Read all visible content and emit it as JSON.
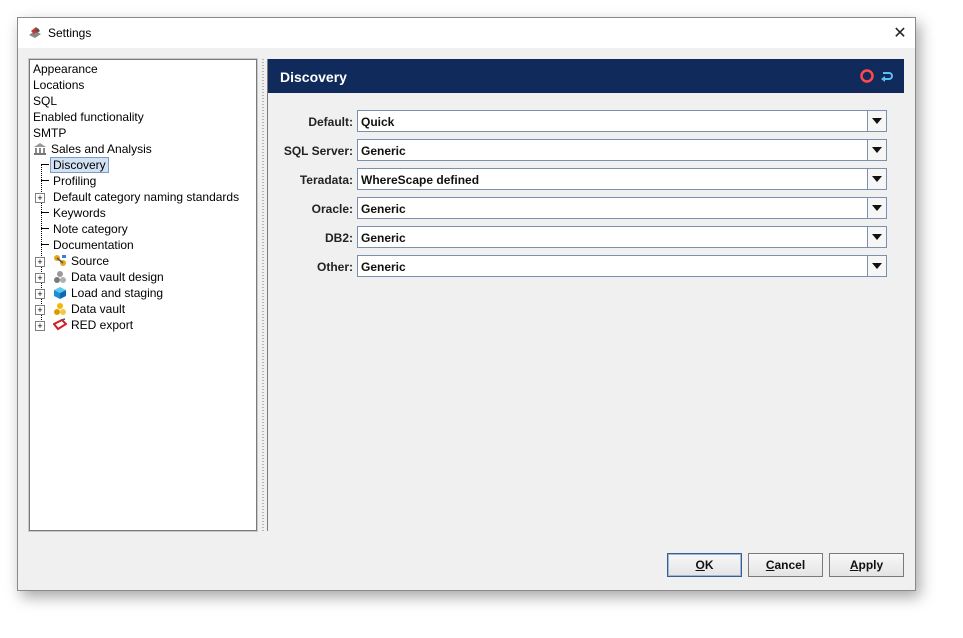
{
  "window": {
    "title": "Settings",
    "close_glyph": "✕"
  },
  "tree": {
    "items": [
      {
        "label": "Appearance"
      },
      {
        "label": "Locations"
      },
      {
        "label": "SQL"
      },
      {
        "label": "Enabled functionality"
      },
      {
        "label": "SMTP"
      },
      {
        "label": "Sales and Analysis",
        "icon": "bank-icon"
      },
      {
        "label": "Discovery",
        "selected": true
      },
      {
        "label": "Profiling"
      },
      {
        "label": "Default category naming standards",
        "expandable": true
      },
      {
        "label": "Keywords"
      },
      {
        "label": "Note category"
      },
      {
        "label": "Documentation"
      },
      {
        "label": "Source",
        "expandable": true,
        "icon": "source-icon"
      },
      {
        "label": "Data vault design",
        "expandable": true,
        "icon": "data-vault-design-icon"
      },
      {
        "label": "Load and staging",
        "expandable": true,
        "icon": "cube-icon"
      },
      {
        "label": "Data vault",
        "expandable": true,
        "icon": "data-vault-icon"
      },
      {
        "label": "RED export",
        "expandable": true,
        "icon": "red-export-icon"
      }
    ]
  },
  "panel": {
    "title": "Discovery",
    "rows": [
      {
        "label": "Default:",
        "value": "Quick"
      },
      {
        "label": "SQL Server:",
        "value": "Generic"
      },
      {
        "label": "Teradata:",
        "value": "WhereScape defined"
      },
      {
        "label": "Oracle:",
        "value": "Generic"
      },
      {
        "label": "DB2:",
        "value": "Generic"
      },
      {
        "label": "Other:",
        "value": "Generic"
      }
    ]
  },
  "buttons": {
    "ok": {
      "mnemonic": "O",
      "rest": "K"
    },
    "cancel": {
      "mnemonic": "C",
      "rest": "ancel"
    },
    "apply": {
      "mnemonic": "A",
      "rest": "pply"
    }
  },
  "colors": {
    "header_bg": "#102a5c",
    "selection_bg": "#d3e2f2"
  }
}
